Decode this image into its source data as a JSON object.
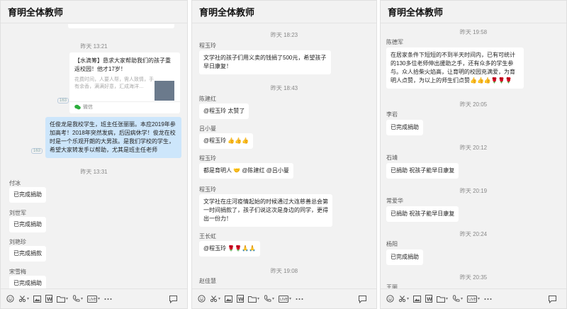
{
  "title": "育明全体教师",
  "p1": {
    "ts1": "昨天 13:21",
    "card_title": "【水滴筹】恳求大家帮助我们的孩子重返校园！他才17岁！",
    "card_desc": "花费时间，人要人帮，需人致情，手有余香，满满好意，汇成海洋…",
    "card_source": "微信",
    "blue_msg": "任俊龙是我校学生，班主任张丽丽。本应2019年参加高考！2018年突然发病，后因病休学！俊龙在校时是一个乐观开朗的大男孩。是我们学校的学生，希望大家转发手以帮助，尤其是班主任老师",
    "ts2": "昨天 13:31",
    "messages": [
      {
        "name": "付冰",
        "text": "已完成捐助"
      },
      {
        "name": "刘世军",
        "text": "已完成捐助"
      },
      {
        "name": "刘艳珍",
        "text": "已完成捐款"
      },
      {
        "name": "宋雪梅",
        "text": "已完成捐助"
      }
    ]
  },
  "p2": {
    "ts1": "昨天 18:23",
    "m1_name": "程玉玲",
    "m1_text": "文学社的孩子们用义卖的钱捐了500元，希望孩子早日康复！",
    "ts2": "昨天 18:43",
    "m2_name": "陈建红",
    "m2_text": "@程玉玲 太赞了",
    "m3_name": "吕小曼",
    "m3_text": "@程玉玲 👍👍👍",
    "m4_name": "程玉玲",
    "m4_text": "都是育明人 🤝 @陈建红 @吕小曼",
    "m5_name": "程玉玲",
    "m5_text": "文学社在庄河疫情起始的时候通过大连慈善总会第一时间捐款了，孩子们说这次是身边的同学，更得出一份力！",
    "m6_name": "王长虹",
    "m6_text": "@程玉玲 🌹🌹🙏🙏",
    "ts3": "昨天 19:08",
    "m7_name": "赵佳慧"
  },
  "p3": {
    "ts1": "昨天 19:58",
    "m1_name": "陈德军",
    "m1_text": "在居家条件下短短的不到半天时间内，已有可统计的130多位老师伸出援助之手，还有众多的学生参与。众人拾柴火焰高，让育明的校园充满爱，为育明人点赞，为以上的师生们点赞👍👍👍🌹🌹🌹",
    "ts2": "昨天 20:05",
    "m2_name": "李岩",
    "m2_text": "已完成捐助",
    "ts3": "昨天 20:12",
    "m3_name": "石靖",
    "m3_text": "已捐助 祝孩子能早日康复",
    "ts4": "昨天 20:19",
    "m4_name": "常爱华",
    "m4_text": "已捐助 祝孩子能早日康复",
    "ts5": "昨天 20:24",
    "m5_name": "杨阳",
    "m5_text": "已完成捐助",
    "ts6": "昨天 20:35",
    "m6_name": "王丽"
  },
  "icons": [
    "emoji-icon",
    "scissors-icon",
    "image-icon",
    "word-icon",
    "folder-icon",
    "phone-icon",
    "live-icon",
    "more-icon",
    "chat-bubble-icon"
  ]
}
